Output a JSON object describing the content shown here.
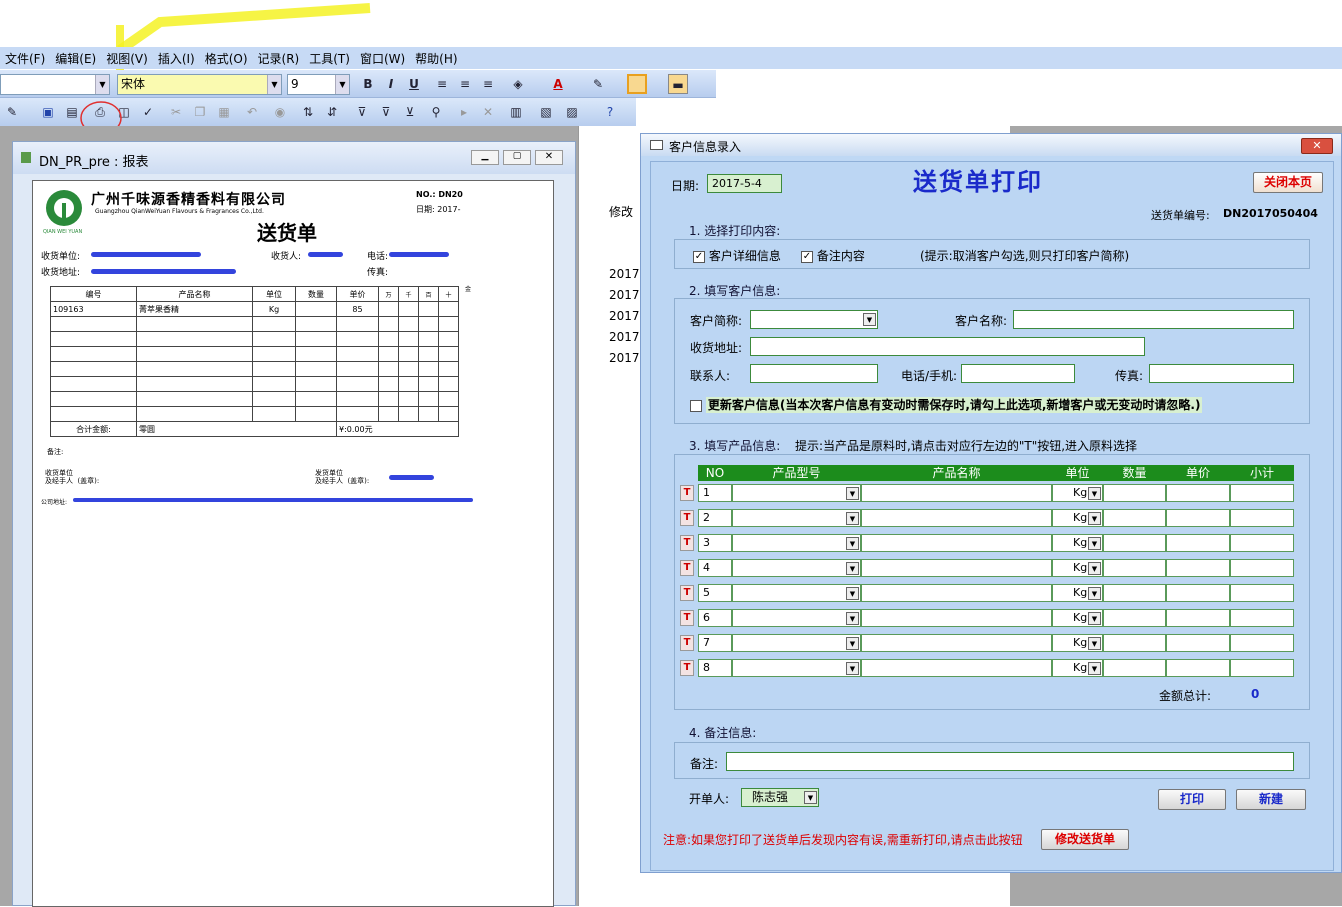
{
  "menu": [
    "文件(F)",
    "编辑(E)",
    "视图(V)",
    "插入(I)",
    "格式(O)",
    "记录(R)",
    "工具(T)",
    "窗口(W)",
    "帮助(H)"
  ],
  "toolbar": {
    "font": "宋体",
    "size": "9",
    "bold": "B",
    "italic": "I",
    "underline": "U"
  },
  "bg_window": {
    "col_label": "修改",
    "rows": [
      "2017-",
      "2017-",
      "2017-",
      "2017-",
      "2017-"
    ]
  },
  "report": {
    "title": "DN_PR_pre : 报表",
    "company_cn": "广州千味源香精香料有限公司",
    "company_en": "Guangzhou QianWeiYuan Flavours & Fragrances Co.,Ltd.",
    "logo_sub": "QIAN WEI YUAN",
    "no_label": "NO.: DN20",
    "date_label": "日期: 2017-",
    "doc_title": "送货单",
    "receiver": "收货单位:",
    "contact": "收货人:",
    "phone": "电话:",
    "address": "收货地址:",
    "fax": "传真:",
    "headers": [
      "编号",
      "产品名称",
      "单位",
      "数量",
      "单价"
    ],
    "money_header": "金",
    "digits": [
      "万",
      "千",
      "百",
      "十"
    ],
    "row": {
      "code": "109163",
      "name": "菁萃果香精",
      "unit": "Kg",
      "price": "85"
    },
    "total_label": "合计金额:",
    "total_cn": "零圆",
    "total_num": "¥:0.00元",
    "remark": "备注:",
    "recv_sign": "收货单位\n及经手人  (盖章):",
    "send_sign": "发货单位\n及经手人  (盖章):",
    "company_addr": "公司地址:"
  },
  "dialog": {
    "title": "客户信息录入",
    "date_label": "日期:",
    "date_value": "2017-5-4",
    "header": "送货单打印",
    "close_btn": "关闭本页",
    "no_label": "送货单编号:",
    "no_value": "DN2017050404",
    "sec1": "1. 选择打印内容:",
    "chk1": "客户详细信息",
    "chk2": "备注内容",
    "hint1": "(提示:取消客户勾选,则只打印客户简称)",
    "sec2": "2. 填写客户信息:",
    "short_name": "客户简称:",
    "full_name": "客户名称:",
    "addr": "收货地址:",
    "person": "联系人:",
    "tel": "电话/手机:",
    "fax": "传真:",
    "update_chk": "更新客户信息(当本次客户信息有变动时需保存时,请勾上此选项,新增客户或无变动时请忽略.)",
    "sec3": "3. 填写产品信息:",
    "hint3": "提示:当产品是原料时,请点击对应行左边的\"T\"按钮,进入原料选择",
    "cols": [
      "NO",
      "产品型号",
      "产品名称",
      "单位",
      "数量",
      "单价",
      "小计"
    ],
    "rows": [
      {
        "no": "1",
        "unit": "Kg"
      },
      {
        "no": "2",
        "unit": "Kg"
      },
      {
        "no": "3",
        "unit": "Kg"
      },
      {
        "no": "4",
        "unit": "Kg"
      },
      {
        "no": "5",
        "unit": "Kg"
      },
      {
        "no": "6",
        "unit": "Kg"
      },
      {
        "no": "7",
        "unit": "Kg"
      },
      {
        "no": "8",
        "unit": "Kg"
      }
    ],
    "t_label": "T",
    "total_label": "金额总计:",
    "total_value": "0",
    "sec4": "4. 备注信息:",
    "remark_label": "备注:",
    "issuer_label": "开单人:",
    "issuer_value": "陈志强",
    "print_btn": "打印",
    "new_btn": "新建",
    "notice": "注意:如果您打印了送货单后发现内容有误,需重新打印,请点击此按钮",
    "modify_btn": "修改送货单"
  }
}
